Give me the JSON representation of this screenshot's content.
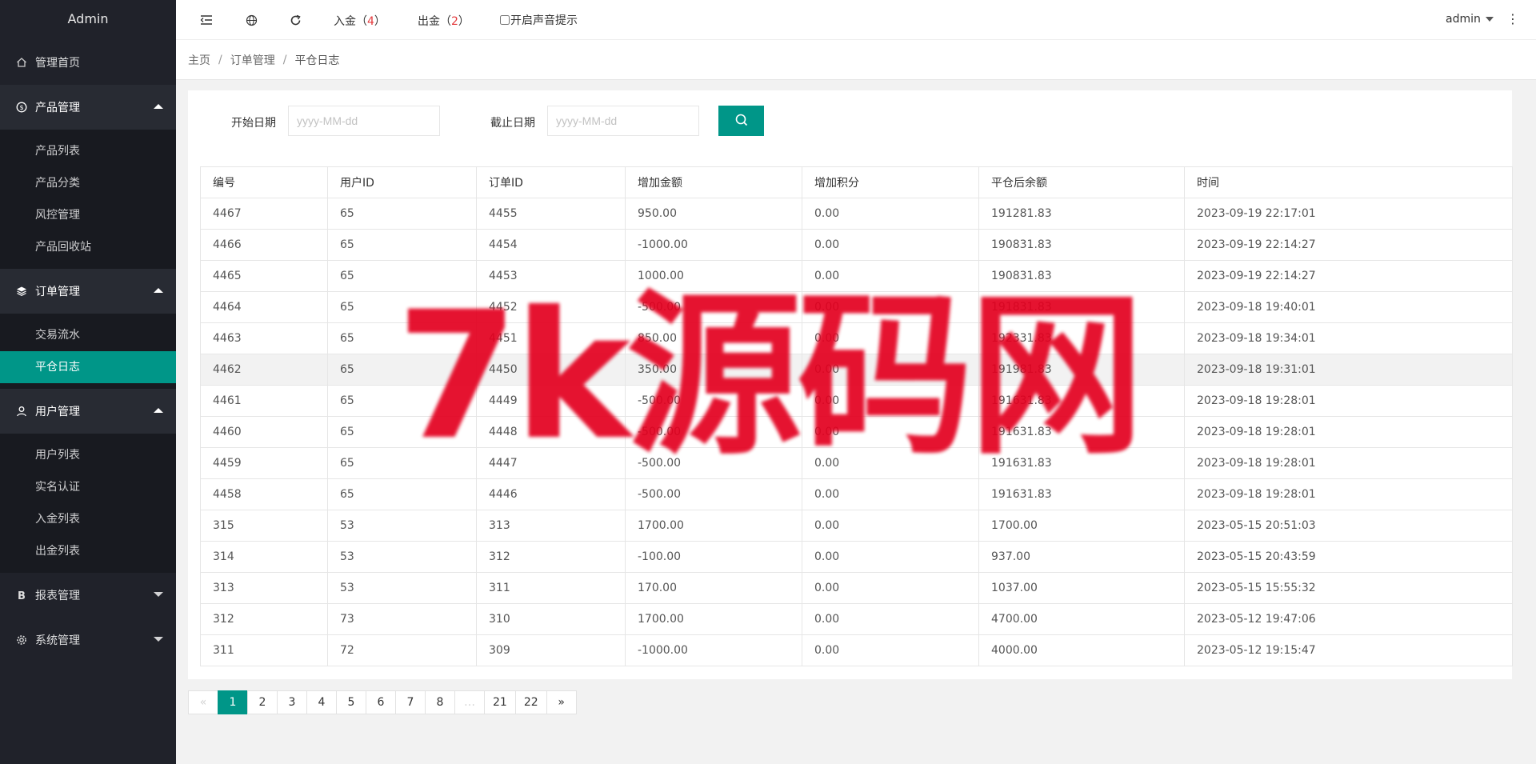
{
  "sidebar": {
    "logo": "Admin",
    "home": "管理首页",
    "groups": [
      {
        "label": "产品管理",
        "items": [
          "产品列表",
          "产品分类",
          "风控管理",
          "产品回收站"
        ]
      },
      {
        "label": "订单管理",
        "items": [
          "交易流水",
          "平仓日志"
        ]
      },
      {
        "label": "用户管理",
        "items": [
          "用户列表",
          "实名认证",
          "入金列表",
          "出金列表"
        ]
      },
      {
        "label": "报表管理"
      },
      {
        "label": "系统管理"
      }
    ],
    "active_item": "平仓日志"
  },
  "header": {
    "deposit_label": "入金（",
    "deposit_count": "4",
    "withdraw_label": "出金（",
    "withdraw_count": "2",
    "close_paren": "）",
    "sound_label": "开启声音提示",
    "user": "admin",
    "more": "⋮"
  },
  "breadcrumb": {
    "items": [
      "主页",
      "订单管理",
      "平仓日志"
    ],
    "sep": "/"
  },
  "filter": {
    "start_label": "开始日期",
    "end_label": "截止日期",
    "placeholder": "yyyy-MM-dd"
  },
  "table": {
    "columns": [
      "编号",
      "用户ID",
      "订单ID",
      "增加金额",
      "增加积分",
      "平仓后余额",
      "时间"
    ],
    "rows": [
      [
        "4467",
        "65",
        "4455",
        "950.00",
        "0.00",
        "191281.83",
        "2023-09-19 22:17:01"
      ],
      [
        "4466",
        "65",
        "4454",
        "-1000.00",
        "0.00",
        "190831.83",
        "2023-09-19 22:14:27"
      ],
      [
        "4465",
        "65",
        "4453",
        "1000.00",
        "0.00",
        "190831.83",
        "2023-09-19 22:14:27"
      ],
      [
        "4464",
        "65",
        "4452",
        "-500.00",
        "0.00",
        "191831.83",
        "2023-09-18 19:40:01"
      ],
      [
        "4463",
        "65",
        "4451",
        "850.00",
        "0.00",
        "192331.83",
        "2023-09-18 19:34:01"
      ],
      [
        "4462",
        "65",
        "4450",
        "350.00",
        "0.00",
        "191981.83",
        "2023-09-18 19:31:01"
      ],
      [
        "4461",
        "65",
        "4449",
        "-500.00",
        "0.00",
        "191631.83",
        "2023-09-18 19:28:01"
      ],
      [
        "4460",
        "65",
        "4448",
        "-500.00",
        "0.00",
        "191631.83",
        "2023-09-18 19:28:01"
      ],
      [
        "4459",
        "65",
        "4447",
        "-500.00",
        "0.00",
        "191631.83",
        "2023-09-18 19:28:01"
      ],
      [
        "4458",
        "65",
        "4446",
        "-500.00",
        "0.00",
        "191631.83",
        "2023-09-18 19:28:01"
      ],
      [
        "315",
        "53",
        "313",
        "1700.00",
        "0.00",
        "1700.00",
        "2023-05-15 20:51:03"
      ],
      [
        "314",
        "53",
        "312",
        "-100.00",
        "0.00",
        "937.00",
        "2023-05-15 20:43:59"
      ],
      [
        "313",
        "53",
        "311",
        "170.00",
        "0.00",
        "1037.00",
        "2023-05-15 15:55:32"
      ],
      [
        "312",
        "73",
        "310",
        "1700.00",
        "0.00",
        "4700.00",
        "2023-05-12 19:47:06"
      ],
      [
        "311",
        "72",
        "309",
        "-1000.00",
        "0.00",
        "4000.00",
        "2023-05-12 19:15:47"
      ]
    ],
    "hover_row": 5
  },
  "pagination": {
    "prev": "«",
    "pages": [
      "1",
      "2",
      "3",
      "4",
      "5",
      "6",
      "7",
      "8",
      "…",
      "21",
      "22"
    ],
    "next": "»",
    "current": "1"
  },
  "watermark": "7k源码网",
  "colors": {
    "accent": "#009688",
    "sidebar_bg": "#20222a",
    "count_red": "#e4393c",
    "watermark_red": "#e3001f"
  },
  "icons": {
    "home": "home-icon",
    "product": "dollar-circle-icon",
    "order": "layers-icon",
    "user": "user-icon",
    "report": "bold-b-icon",
    "system": "gear-icon",
    "flexible": "menu-fold-icon",
    "website": "globe-icon",
    "refresh": "refresh-icon",
    "search": "search-icon"
  }
}
